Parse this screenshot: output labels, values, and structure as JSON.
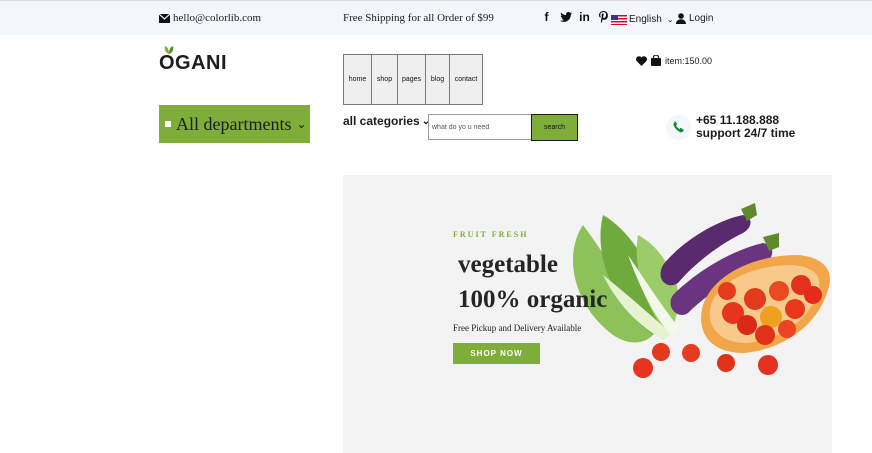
{
  "topbar": {
    "email": "hello@colorlib.com",
    "shipping": "Free Shipping for all Order of $99",
    "language": "English",
    "login": "Login",
    "socials": [
      "facebook-icon",
      "twitter-icon",
      "linkedin-icon",
      "pinterest-icon"
    ]
  },
  "header": {
    "logo": "OGANI",
    "nav": [
      "home",
      "shop",
      "pages",
      "blog",
      "contact"
    ],
    "cart_total": "item:150.00"
  },
  "departments": {
    "label": "All departments"
  },
  "search": {
    "categories_label": "all categories",
    "placeholder": "what do yo u need",
    "button": "search"
  },
  "contact": {
    "phone": "+65 11.188.888",
    "support": "support 24/7 time"
  },
  "hero": {
    "tag": "FRUIT FRESH",
    "title_line1": "vegetable",
    "title_line2": "100% organic",
    "subtitle": "Free Pickup and Delivery Available",
    "button": "SHOP NOW"
  },
  "colors": {
    "accent": "#7fad39",
    "topbar_bg": "#f3f6fa",
    "hero_bg": "#f3f3f3"
  }
}
